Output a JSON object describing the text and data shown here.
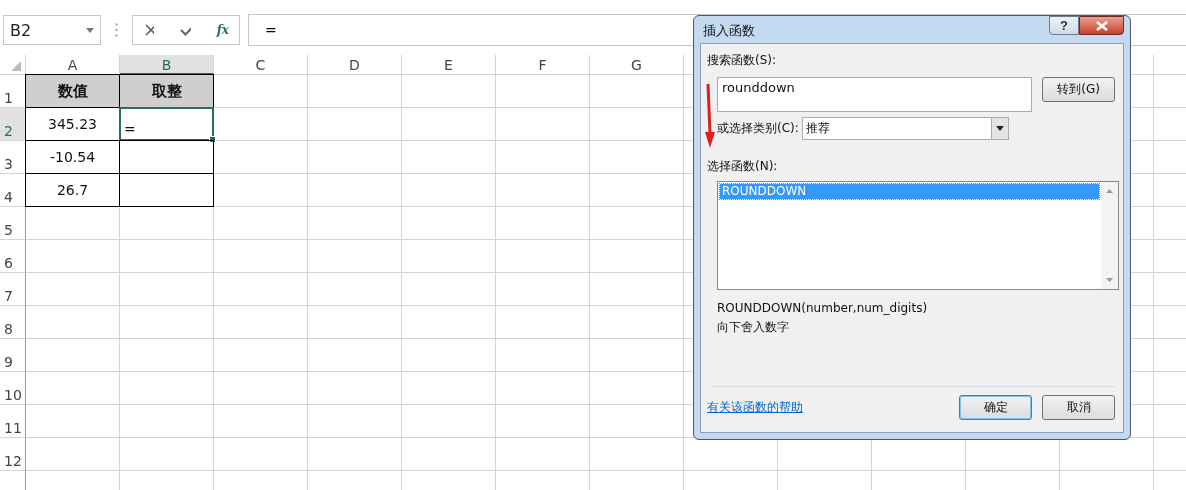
{
  "name_box": {
    "value": "B2"
  },
  "formula_bar": {
    "fx_label": "fx",
    "value": "="
  },
  "sheet": {
    "columns": [
      {
        "label": "A",
        "selected": false
      },
      {
        "label": "B",
        "selected": true
      },
      {
        "label": "C",
        "selected": false
      },
      {
        "label": "D",
        "selected": false
      },
      {
        "label": "E",
        "selected": false
      },
      {
        "label": "F",
        "selected": false
      },
      {
        "label": "G",
        "selected": false
      }
    ],
    "rows": [
      {
        "label": "1",
        "selected": false,
        "cells": [
          {
            "value": "数值",
            "kind": "header"
          },
          {
            "value": "取整",
            "kind": "header"
          }
        ]
      },
      {
        "label": "2",
        "selected": true,
        "cells": [
          {
            "value": "345.23",
            "kind": "number"
          },
          {
            "value": "=",
            "kind": "editing",
            "selected": true
          }
        ]
      },
      {
        "label": "3",
        "selected": false,
        "cells": [
          {
            "value": "-10.54",
            "kind": "number"
          },
          {
            "kind": "number"
          }
        ]
      },
      {
        "label": "4",
        "selected": false,
        "cells": [
          {
            "value": "26.7",
            "kind": "number"
          },
          {
            "kind": "number"
          }
        ]
      },
      {
        "label": "5",
        "selected": false
      },
      {
        "label": "6",
        "selected": false
      },
      {
        "label": "7",
        "selected": false
      },
      {
        "label": "8",
        "selected": false
      },
      {
        "label": "9",
        "selected": false
      },
      {
        "label": "10",
        "selected": false
      },
      {
        "label": "11",
        "selected": false
      },
      {
        "label": "12",
        "selected": false
      }
    ]
  },
  "dialog": {
    "title": "插入函数",
    "help_button": "?",
    "search_label": "搜索函数(S):",
    "search_value": "rounddown",
    "go_button": "转到(G)",
    "category_label": "或选择类别(C):",
    "category_value": "推荐",
    "functions_label": "选择函数(N):",
    "functions": [
      {
        "name": "ROUNDDOWN",
        "selected": true
      }
    ],
    "signature": "ROUNDDOWN(number,num_digits)",
    "description": "向下舍入数字",
    "help_link": "有关该函数的帮助",
    "buttons": [
      {
        "label": "确定",
        "default": true
      },
      {
        "label": "取消",
        "default": false
      }
    ]
  }
}
